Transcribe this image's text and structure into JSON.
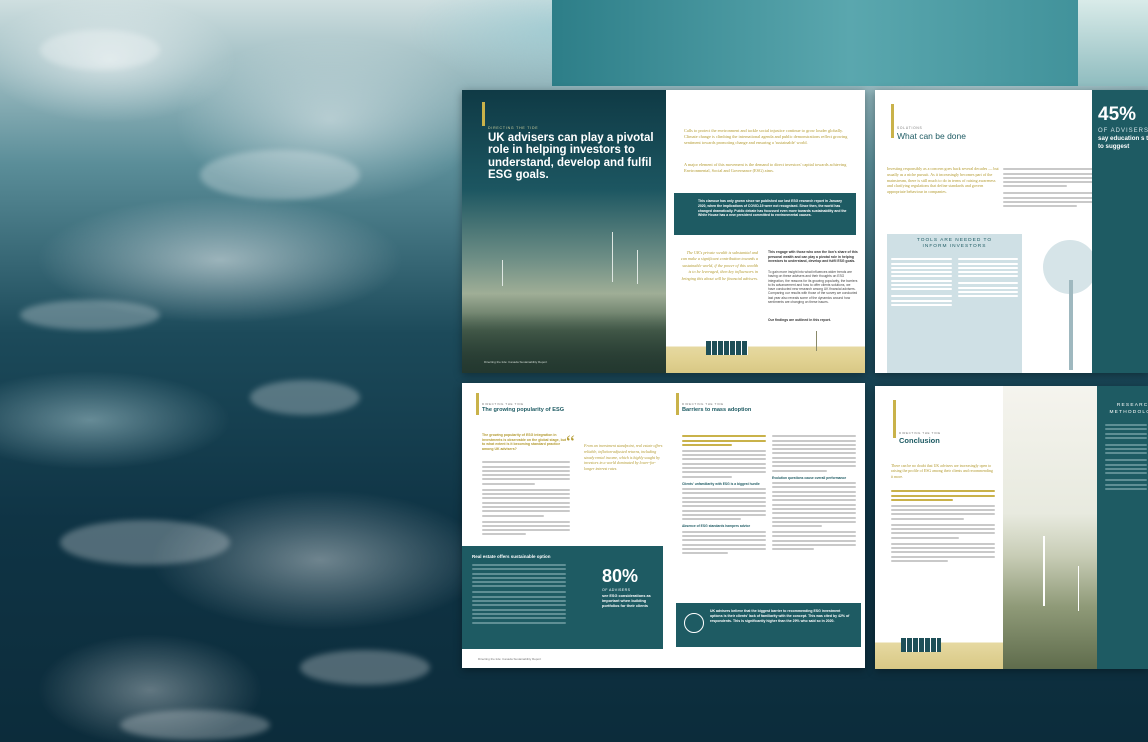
{
  "spread1": {
    "kicker": "DIRECTING THE TIDE",
    "headline": "UK advisers can play a pivotal role in helping investors to understand, develop and fulfil ESG goals.",
    "intro1": "Calls to protect the environment and tackle social injustice continue to grow louder globally. Climate change is climbing the international agenda and public demonstrations reflect growing sentiment towards promoting change and ensuring a 'sustainable' world.",
    "intro2": "A major element of this movement is the demand to direct investors' capital towards achieving Environmental, Social and Governance (ESG) aims.",
    "callout": "This clamour has only grown since we published our last ESG research report in January 2020, when the implications of COVID-19 were not recognised. Since then, the world has changed dramatically. Public debate has focussed even more towards sustainability and the White House has a new president committed to environmental causes.",
    "pullquote": "The UK's private wealth is substantial and can make a significant contribution towards a sustainable world, if the power of this wealth is to be leveraged, then key influencers in bringing this about will be financial advisers.",
    "body_bold": "This engage with those who own the lion's share of this personal wealth and can play a pivotal role in helping investors to understand, develop and fulfil ESG goals.",
    "body2": "To gain more insight into what influences wider trends are having on these advisers and their thoughts on ESG integration, the reasons for its growing popularity, the barriers to its advancement and how to offer clients solutions, we have conducted new research among UK financial advisers. Comparing our results with those of the survey we conducted last year also reveals some of the dynamics around how sentiments are changing on these issues.",
    "body3": "Our findings are outlined in this report.",
    "footer": "Directing the tide: Canada Sustainability Report"
  },
  "spread2": {
    "kicker": "SOLUTIONS",
    "title": "What can be done",
    "quote": "Investing responsibly as a concern goes back several decades — but usually as a niche pursuit. As it increasingly becomes part of the mainstream, there is still much to do in terms of raising awareness and clarifying regulations that define standards and govern appropriate behaviour in companies.",
    "box_title": "TOOLS ARE NEEDED TO INFORM INVESTORS",
    "stat": "45%",
    "stat_label": "OF ADVISERS",
    "stat_text": "say education s them to suggest"
  },
  "spread3": {
    "kicker_left": "DIRECTING THE TIDE",
    "title_left": "The growing popularity of ESG",
    "kicker_right": "DIRECTING THE TIDE",
    "title_right": "Barriers to mass adoption",
    "lead": "The growing popularity of ESG integration in investments is observable on the global stage, but to what extent is it becoming standard practice among UK advisers?",
    "quote": "From an investment standpoint, real estate offers reliable, inflation-adjusted returns, including steady rental income, which is highly sought by investors in a world dominated by lower-for-longer interest rates.",
    "box_heading": "Real estate offers sustainable option",
    "stat": "80%",
    "stat_label": "OF ADVISERS",
    "stat_text": "see ESG considerations as important when building portfolios for their clients",
    "sub1": "Clients' unfamiliarity with ESG is a biggest hurdle",
    "sub2": "Absence of ESG standards hampers advice",
    "sub3": "Evolution questions cause overall performance",
    "bottom_callout": "UK advisers believe that the biggest barrier to recommending ESG investment options is their clients' lack of familiarity with the concept. This was cited by 42% of respondents. This is significantly higher than the 29% who said so in 2020.",
    "footer": "Directing the tide: Canada Sustainability Report"
  },
  "spread4": {
    "kicker": "DIRECTING THE TIDE",
    "title": "Conclusion",
    "lead": "There can be no doubt that UK advisers are increasingly open to raising the profile of ESG among their clients and recommending it more.",
    "right_title": "RESEARCH METHODOLOGY"
  }
}
